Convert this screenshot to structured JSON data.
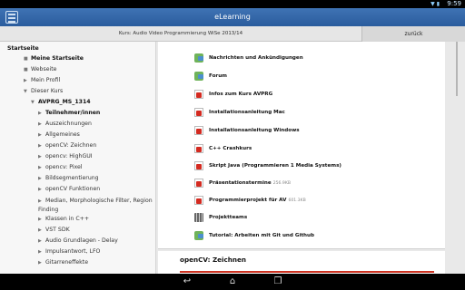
{
  "status_bar": {
    "time": "9:59",
    "icons": "▼ ▮"
  },
  "action_bar": {
    "title": "eLearning"
  },
  "sub_header": {
    "course": "Kurs: Audio Video Programmierung WiSe 2013/14",
    "back_label": "zurück"
  },
  "nav": {
    "items": [
      {
        "label": "Startseite",
        "style": "bold",
        "mark": ""
      },
      {
        "label": "Meine Startseite",
        "style": "bold",
        "mark": "■"
      },
      {
        "label": "Webseite",
        "style": "normal",
        "mark": "■"
      },
      {
        "label": "Mein Profil",
        "style": "normal",
        "mark": "▶"
      },
      {
        "label": "Dieser Kurs",
        "style": "normal",
        "mark": "▼"
      },
      {
        "label": "AVPRG_MS_1314",
        "style": "bold",
        "mark": "▼"
      },
      {
        "label": "Teilnehmer/innen",
        "style": "bold",
        "mark": "▶"
      },
      {
        "label": "Auszeichnungen",
        "style": "normal",
        "mark": "▶"
      },
      {
        "label": "Allgemeines",
        "style": "normal",
        "mark": "▶"
      },
      {
        "label": "openCV: Zeichnen",
        "style": "normal",
        "mark": "▶"
      },
      {
        "label": "opencv: HighGUI",
        "style": "normal",
        "mark": "▶"
      },
      {
        "label": "opencv: Pixel",
        "style": "normal",
        "mark": "▶"
      },
      {
        "label": "Bildsegmentierung",
        "style": "normal",
        "mark": "▶"
      },
      {
        "label": "openCV Funktionen",
        "style": "normal",
        "mark": "▶"
      },
      {
        "label": "Median, Morphologische Filter, Region Finding",
        "style": "normal",
        "mark": "▶"
      },
      {
        "label": "Klassen in C++",
        "style": "normal",
        "mark": "▶"
      },
      {
        "label": "VST SDK",
        "style": "normal",
        "mark": "▶"
      },
      {
        "label": "Audio Grundlagen - Delay",
        "style": "normal",
        "mark": "▶"
      },
      {
        "label": "Impulsantwort, LFO",
        "style": "normal",
        "mark": "▶"
      },
      {
        "label": "Gitarreneffekte",
        "style": "normal",
        "mark": "▶"
      }
    ]
  },
  "main": {
    "resources": [
      {
        "label": "Nachrichten und Ankündigungen",
        "icon": "forum-icon",
        "meta": ""
      },
      {
        "label": "Forum",
        "icon": "forum-icon",
        "meta": ""
      },
      {
        "label": "Infos zum Kurs AVPRG",
        "icon": "pdf-icon",
        "meta": ""
      },
      {
        "label": "Installationsanleitung Mac",
        "icon": "pdf-icon",
        "meta": ""
      },
      {
        "label": "Installationsanleitung Windows",
        "icon": "pdf-icon",
        "meta": ""
      },
      {
        "label": "C++ Crashkurs",
        "icon": "pdf-icon",
        "meta": ""
      },
      {
        "label": "Skript Java (Programmieren 1 Media Systems)",
        "icon": "pdf-icon",
        "meta": ""
      },
      {
        "label": "Präsentationstermine",
        "icon": "pdf-icon",
        "meta": "256.9KB"
      },
      {
        "label": "Programmierprojekt für AV",
        "icon": "pdf-icon",
        "meta": "601.3KB"
      },
      {
        "label": "Projektteams",
        "icon": "grid-icon",
        "meta": ""
      },
      {
        "label": "Tutorial: Arbeiten mit Git und Github",
        "icon": "forum-icon",
        "meta": ""
      }
    ],
    "next_section": "openCV: Zeichnen"
  },
  "colors": {
    "action_bar": "#2f64a8",
    "accent_bar": "#cc3322",
    "pdf_red": "#d42a20"
  }
}
